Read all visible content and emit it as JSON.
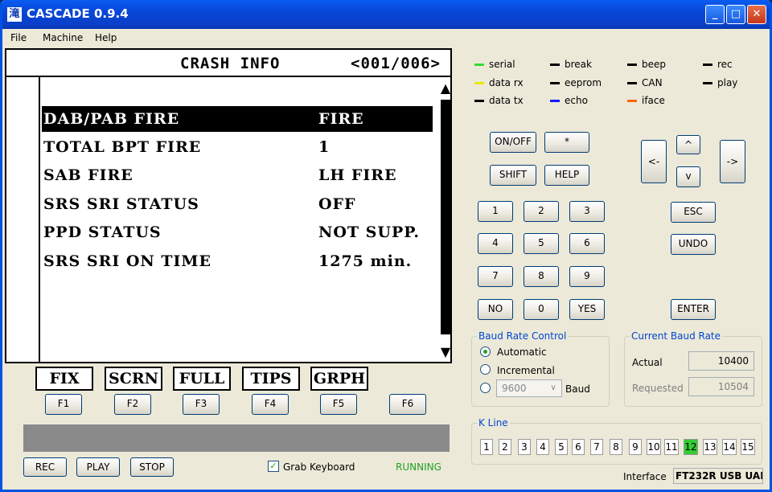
{
  "window": {
    "title": "CASCADE 0.9.4",
    "icon_glyph": "滝"
  },
  "menu": [
    "File",
    "Machine",
    "Help"
  ],
  "lcd": {
    "title": "CRASH INFO",
    "page": "<001/006>",
    "rows": [
      {
        "key": "DAB/PAB FIRE",
        "value": "FIRE",
        "selected": true
      },
      {
        "key": "TOTAL BPT FIRE",
        "value": "1"
      },
      {
        "key": "SAB FIRE",
        "value": "LH FIRE"
      },
      {
        "key": "SRS SRI STATUS",
        "value": "OFF"
      },
      {
        "key": "PPD STATUS",
        "value": "NOT SUPP."
      },
      {
        "key": "SRS SRI ON TIME",
        "value": "1275 min."
      }
    ],
    "scroll_up": "▲",
    "scroll_down": "▼"
  },
  "fkey_labels": [
    "FIX",
    "SCRN",
    "FULL",
    "TIPS",
    "GRPH"
  ],
  "fkeys": [
    "F1",
    "F2",
    "F3",
    "F4",
    "F5",
    "F6"
  ],
  "transport": {
    "rec": "REC",
    "play": "PLAY",
    "stop": "STOP"
  },
  "grab_keyboard": {
    "label": "Grab Keyboard",
    "checked": true,
    "mark": "✓"
  },
  "status": {
    "text": "RUNNING",
    "color": "#21a121"
  },
  "leds": [
    {
      "label": "serial",
      "color": "#33dd33"
    },
    {
      "label": "break",
      "color": "#000000"
    },
    {
      "label": "beep",
      "color": "#000000"
    },
    {
      "label": "rec",
      "color": "#000000"
    },
    {
      "label": "data rx",
      "color": "#e8e800"
    },
    {
      "label": "eeprom",
      "color": "#000000"
    },
    {
      "label": "CAN",
      "color": "#000000"
    },
    {
      "label": "play",
      "color": "#000000"
    },
    {
      "label": "data tx",
      "color": "#000000"
    },
    {
      "label": "echo",
      "color": "#1a1aff"
    },
    {
      "label": "iface",
      "color": "#ff6600"
    }
  ],
  "keypad": {
    "onoff": "ON/OFF",
    "star": "*",
    "shift": "SHIFT",
    "help": "HELP",
    "nums": [
      "1",
      "2",
      "3",
      "4",
      "5",
      "6",
      "7",
      "8",
      "9"
    ],
    "no": "NO",
    "zero": "0",
    "yes": "YES",
    "up": "^",
    "down": "v",
    "left": "<-",
    "right": "->",
    "esc": "ESC",
    "undo": "UNDO",
    "enter": "ENTER"
  },
  "baud_control": {
    "title": "Baud Rate Control",
    "automatic": "Automatic",
    "incremental": "Incremental",
    "selected": "Automatic",
    "select_value": "9600",
    "select_arrow": "∨",
    "baud_label": "Baud"
  },
  "current_baud": {
    "title": "Current Baud Rate",
    "actual_label": "Actual",
    "actual": "10400",
    "requested_label": "Requested",
    "requested": "10504"
  },
  "kline": {
    "title": "K Line",
    "lines": [
      "1",
      "2",
      "3",
      "4",
      "5",
      "6",
      "7",
      "8",
      "9",
      "10",
      "11",
      "12",
      "13",
      "14",
      "15"
    ],
    "active": "12"
  },
  "interface": {
    "label": "Interface",
    "value": "FT232R USB UAF"
  }
}
